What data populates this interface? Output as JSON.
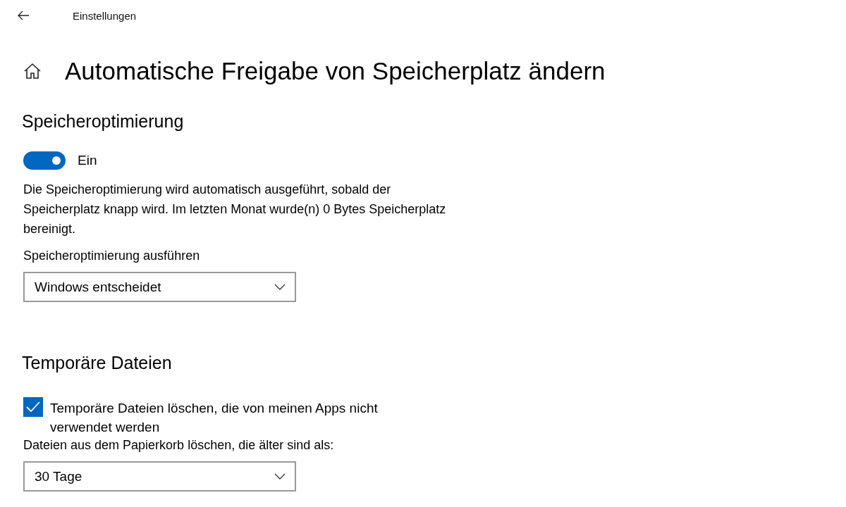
{
  "window": {
    "title": "Einstellungen"
  },
  "page": {
    "title": "Automatische Freigabe von Speicherplatz ändern"
  },
  "sections": [
    {
      "heading": "Speicheroptimierung",
      "items": [
        {
          "kind": "toggle",
          "on": true,
          "label": "Ein"
        },
        {
          "kind": "text",
          "text": "Die Speicheroptimierung wird automatisch ausgeführt, sobald der Speicherplatz knapp wird. Im letzten Monat wurde(n) 0 Bytes Speicherplatz bereinigt."
        },
        {
          "kind": "dropdown",
          "label": "Speicheroptimierung ausführen",
          "value": "Windows entscheidet"
        }
      ]
    },
    {
      "heading": "Temporäre Dateien",
      "items": [
        {
          "kind": "checkbox",
          "checked": true,
          "label": "Temporäre Dateien löschen, die von meinen Apps nicht verwendet werden"
        },
        {
          "kind": "dropdown",
          "label": "Dateien aus dem Papierkorb löschen, die älter sind als:",
          "value": "30 Tage"
        }
      ]
    }
  ]
}
